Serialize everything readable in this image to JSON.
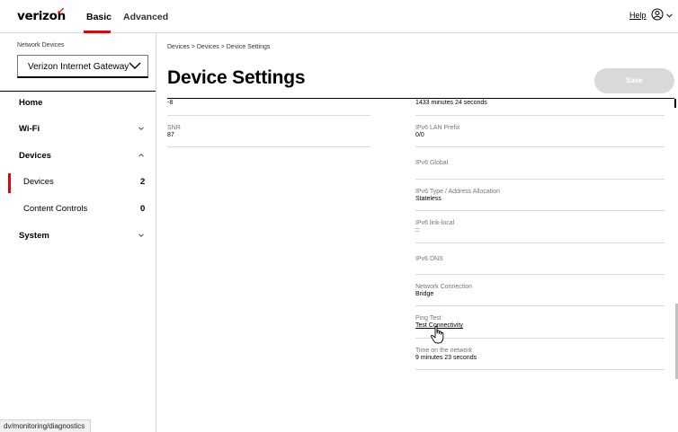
{
  "header": {
    "logo": "verizon",
    "tabs": [
      {
        "label": "Basic",
        "active": true
      },
      {
        "label": "Advanced",
        "active": false
      }
    ],
    "help_label": "Help",
    "accent_color": "#ee0000"
  },
  "sidebar": {
    "network_devices_label": "Network Devices",
    "selected_device": "Verizon Internet Gateway",
    "items": [
      {
        "label": "Home"
      },
      {
        "label": "Wi-Fi",
        "expanded": false
      },
      {
        "label": "Devices",
        "expanded": true
      },
      {
        "label": "Devices",
        "count": "2",
        "active": true
      },
      {
        "label": "Content Controls",
        "count": "0"
      },
      {
        "label": "System",
        "expanded": false
      }
    ]
  },
  "main": {
    "breadcrumb": "Devices  >  Devices  >  Device Settings",
    "title": "Device Settings",
    "save_label": "Save",
    "left_fields": [
      {
        "label": "",
        "value": "-8"
      },
      {
        "label": "SNR",
        "value": "87"
      }
    ],
    "right_fields": [
      {
        "label": "",
        "value": "1433 minutes 24 seconds"
      },
      {
        "label": "IPv6 LAN Prefix",
        "value": "0/0"
      },
      {
        "label": "IPv6 Global",
        "value": ""
      },
      {
        "label": "IPv6 Type / Address Allocation",
        "value": "Stateless"
      },
      {
        "label": "IPv6 link-local",
        "value": "::"
      },
      {
        "label": "IPv6 DNS",
        "value": ""
      },
      {
        "label": "Network Connection",
        "value": "Bridge"
      },
      {
        "label": "Ping Test",
        "value": "Test Connectivity"
      },
      {
        "label": "Time on the network",
        "value": "9 minutes 23 seconds"
      }
    ]
  },
  "status_bar": {
    "url": "dv/monitoring/diagnostics"
  }
}
